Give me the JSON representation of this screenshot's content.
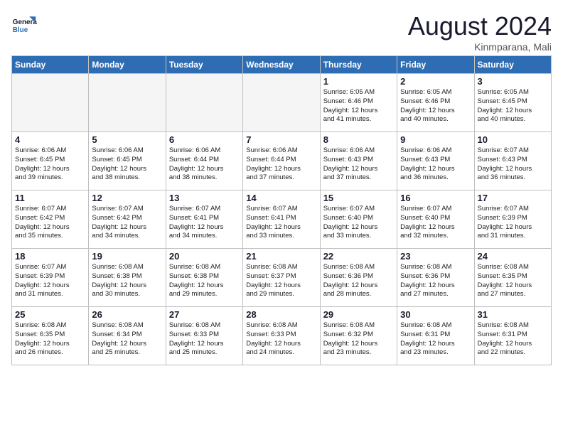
{
  "logo": {
    "line1": "General",
    "line2": "Blue"
  },
  "title": "August 2024",
  "location": "Kinmparana, Mali",
  "weekdays": [
    "Sunday",
    "Monday",
    "Tuesday",
    "Wednesday",
    "Thursday",
    "Friday",
    "Saturday"
  ],
  "weeks": [
    [
      {
        "day": "",
        "info": ""
      },
      {
        "day": "",
        "info": ""
      },
      {
        "day": "",
        "info": ""
      },
      {
        "day": "",
        "info": ""
      },
      {
        "day": "1",
        "info": "Sunrise: 6:05 AM\nSunset: 6:46 PM\nDaylight: 12 hours\nand 41 minutes."
      },
      {
        "day": "2",
        "info": "Sunrise: 6:05 AM\nSunset: 6:46 PM\nDaylight: 12 hours\nand 40 minutes."
      },
      {
        "day": "3",
        "info": "Sunrise: 6:05 AM\nSunset: 6:45 PM\nDaylight: 12 hours\nand 40 minutes."
      }
    ],
    [
      {
        "day": "4",
        "info": "Sunrise: 6:06 AM\nSunset: 6:45 PM\nDaylight: 12 hours\nand 39 minutes."
      },
      {
        "day": "5",
        "info": "Sunrise: 6:06 AM\nSunset: 6:45 PM\nDaylight: 12 hours\nand 38 minutes."
      },
      {
        "day": "6",
        "info": "Sunrise: 6:06 AM\nSunset: 6:44 PM\nDaylight: 12 hours\nand 38 minutes."
      },
      {
        "day": "7",
        "info": "Sunrise: 6:06 AM\nSunset: 6:44 PM\nDaylight: 12 hours\nand 37 minutes."
      },
      {
        "day": "8",
        "info": "Sunrise: 6:06 AM\nSunset: 6:43 PM\nDaylight: 12 hours\nand 37 minutes."
      },
      {
        "day": "9",
        "info": "Sunrise: 6:06 AM\nSunset: 6:43 PM\nDaylight: 12 hours\nand 36 minutes."
      },
      {
        "day": "10",
        "info": "Sunrise: 6:07 AM\nSunset: 6:43 PM\nDaylight: 12 hours\nand 36 minutes."
      }
    ],
    [
      {
        "day": "11",
        "info": "Sunrise: 6:07 AM\nSunset: 6:42 PM\nDaylight: 12 hours\nand 35 minutes."
      },
      {
        "day": "12",
        "info": "Sunrise: 6:07 AM\nSunset: 6:42 PM\nDaylight: 12 hours\nand 34 minutes."
      },
      {
        "day": "13",
        "info": "Sunrise: 6:07 AM\nSunset: 6:41 PM\nDaylight: 12 hours\nand 34 minutes."
      },
      {
        "day": "14",
        "info": "Sunrise: 6:07 AM\nSunset: 6:41 PM\nDaylight: 12 hours\nand 33 minutes."
      },
      {
        "day": "15",
        "info": "Sunrise: 6:07 AM\nSunset: 6:40 PM\nDaylight: 12 hours\nand 33 minutes."
      },
      {
        "day": "16",
        "info": "Sunrise: 6:07 AM\nSunset: 6:40 PM\nDaylight: 12 hours\nand 32 minutes."
      },
      {
        "day": "17",
        "info": "Sunrise: 6:07 AM\nSunset: 6:39 PM\nDaylight: 12 hours\nand 31 minutes."
      }
    ],
    [
      {
        "day": "18",
        "info": "Sunrise: 6:07 AM\nSunset: 6:39 PM\nDaylight: 12 hours\nand 31 minutes."
      },
      {
        "day": "19",
        "info": "Sunrise: 6:08 AM\nSunset: 6:38 PM\nDaylight: 12 hours\nand 30 minutes."
      },
      {
        "day": "20",
        "info": "Sunrise: 6:08 AM\nSunset: 6:38 PM\nDaylight: 12 hours\nand 29 minutes."
      },
      {
        "day": "21",
        "info": "Sunrise: 6:08 AM\nSunset: 6:37 PM\nDaylight: 12 hours\nand 29 minutes."
      },
      {
        "day": "22",
        "info": "Sunrise: 6:08 AM\nSunset: 6:36 PM\nDaylight: 12 hours\nand 28 minutes."
      },
      {
        "day": "23",
        "info": "Sunrise: 6:08 AM\nSunset: 6:36 PM\nDaylight: 12 hours\nand 27 minutes."
      },
      {
        "day": "24",
        "info": "Sunrise: 6:08 AM\nSunset: 6:35 PM\nDaylight: 12 hours\nand 27 minutes."
      }
    ],
    [
      {
        "day": "25",
        "info": "Sunrise: 6:08 AM\nSunset: 6:35 PM\nDaylight: 12 hours\nand 26 minutes."
      },
      {
        "day": "26",
        "info": "Sunrise: 6:08 AM\nSunset: 6:34 PM\nDaylight: 12 hours\nand 25 minutes."
      },
      {
        "day": "27",
        "info": "Sunrise: 6:08 AM\nSunset: 6:33 PM\nDaylight: 12 hours\nand 25 minutes."
      },
      {
        "day": "28",
        "info": "Sunrise: 6:08 AM\nSunset: 6:33 PM\nDaylight: 12 hours\nand 24 minutes."
      },
      {
        "day": "29",
        "info": "Sunrise: 6:08 AM\nSunset: 6:32 PM\nDaylight: 12 hours\nand 23 minutes."
      },
      {
        "day": "30",
        "info": "Sunrise: 6:08 AM\nSunset: 6:31 PM\nDaylight: 12 hours\nand 23 minutes."
      },
      {
        "day": "31",
        "info": "Sunrise: 6:08 AM\nSunset: 6:31 PM\nDaylight: 12 hours\nand 22 minutes."
      }
    ]
  ]
}
